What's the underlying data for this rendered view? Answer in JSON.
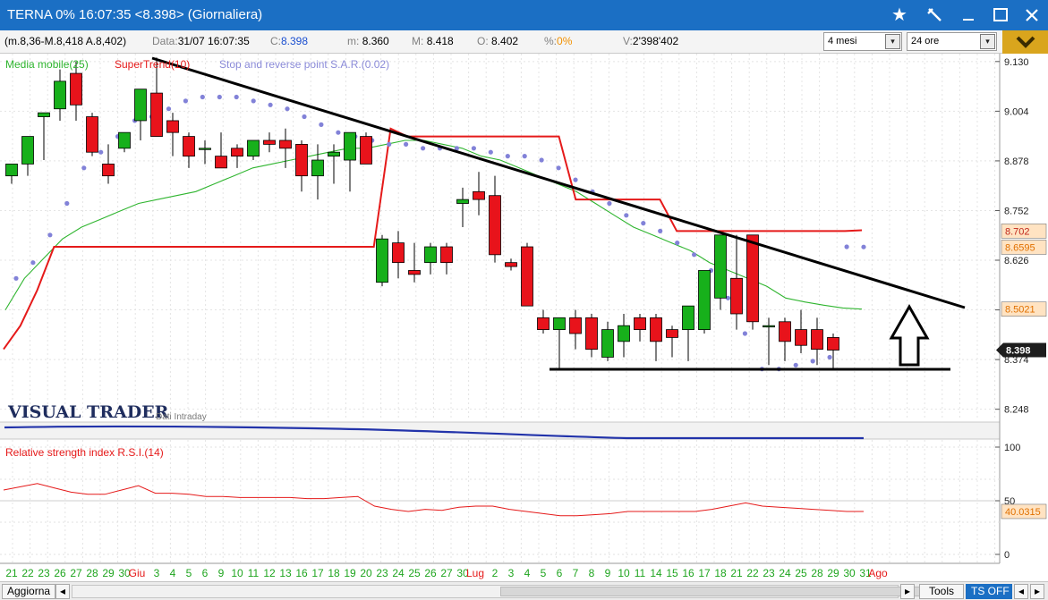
{
  "window": {
    "title": "TERNA 0%  16:07:35  <8.398>  (Giornaliera)",
    "controls": [
      "star-icon",
      "pin-icon",
      "minimize-icon",
      "maximize-icon",
      "close-icon"
    ]
  },
  "infobar": {
    "range_label": "(m.8,36-M.8,418 A.8,402)",
    "data_label": "Data:",
    "data_value": "31/07 16:07:35",
    "c_label": "C:",
    "c_value": "8.398",
    "m_label": "m:",
    "m_value": "8.360",
    "M_label": "M:",
    "M_value": "8.418",
    "o_label": "O:",
    "o_value": "8.402",
    "pct_label": "%:",
    "pct_value": "0%",
    "v_label": "V:",
    "v_value": "2'398'402",
    "period_select": "4 mesi",
    "interval_select": "24 ore"
  },
  "legend": {
    "ma": "Media mobile(25)",
    "supertrend": "SuperTrend(10)",
    "sar": "Stop and reverse point S.A.R.(0.02)"
  },
  "watermark": {
    "brand": "VISUAL TRADER",
    "sub": "Dati Intraday"
  },
  "price_axis": {
    "ticks": [
      "9.130",
      "9.004",
      "8.878",
      "8.752",
      "8.626",
      "8.500",
      "8.374",
      "8.248"
    ],
    "ytick_values": [
      9.13,
      9.004,
      8.878,
      8.752,
      8.626,
      8.5,
      8.374,
      8.248
    ]
  },
  "price_labels": {
    "supertrend": "8.702",
    "sar": "8.6595",
    "ma": "8.5021",
    "last": "8.398"
  },
  "rsi": {
    "label": "Relative strength index R.S.I.(14)",
    "ticks": [
      "100",
      "50",
      "0"
    ],
    "last": "40.0315"
  },
  "x_axis": {
    "labels": [
      "21",
      "22",
      "23",
      "26",
      "27",
      "28",
      "29",
      "30",
      "Giu",
      "3",
      "4",
      "5",
      "6",
      "9",
      "10",
      "11",
      "12",
      "13",
      "16",
      "17",
      "18",
      "19",
      "20",
      "23",
      "24",
      "25",
      "26",
      "27",
      "30",
      "Lug",
      "2",
      "3",
      "4",
      "5",
      "6",
      "7",
      "8",
      "9",
      "10",
      "11",
      "14",
      "15",
      "16",
      "17",
      "18",
      "21",
      "22",
      "23",
      "24",
      "25",
      "28",
      "29",
      "30",
      "31",
      "Ago"
    ],
    "highlight": [
      "Giu",
      "Lug",
      "Ago"
    ]
  },
  "bottombar": {
    "refresh": "Aggiorna",
    "tools": "Tools",
    "ts": "TS OFF"
  },
  "colors": {
    "up": "#17b01b",
    "down": "#e8131b",
    "ma": "#2fb52f",
    "supertrend": "#e51a1a",
    "sar": "#8282d8",
    "rsi": "#e51a1a",
    "volume": "#2233aa",
    "titlebar": "#1b6fc4"
  },
  "chart_data": {
    "type": "candlestick",
    "x": [
      "21",
      "22",
      "23",
      "26",
      "27",
      "28",
      "29",
      "30",
      "Giu",
      "3",
      "4",
      "5",
      "6",
      "9",
      "10",
      "11",
      "12",
      "13",
      "16",
      "17",
      "18",
      "19",
      "20",
      "23",
      "24",
      "25",
      "26",
      "27",
      "30",
      "Lug",
      "2",
      "3",
      "4",
      "5",
      "6",
      "7",
      "8",
      "9",
      "10",
      "11",
      "14",
      "15",
      "16",
      "17",
      "18",
      "21",
      "22",
      "23",
      "24",
      "25",
      "28",
      "29",
      "30",
      "31"
    ],
    "open": [
      8.84,
      8.87,
      8.99,
      9.01,
      9.1,
      8.99,
      8.87,
      8.91,
      8.98,
      9.05,
      8.98,
      8.94,
      8.91,
      8.89,
      8.91,
      8.89,
      8.93,
      8.93,
      8.92,
      8.84,
      8.89,
      8.88,
      8.94,
      8.57,
      8.67,
      8.6,
      8.62,
      8.66,
      8.77,
      8.8,
      8.79,
      8.62,
      8.66,
      8.48,
      8.45,
      8.48,
      8.48,
      8.38,
      8.42,
      8.48,
      8.48,
      8.45,
      8.45,
      8.45,
      8.53,
      8.58,
      8.69,
      8.46,
      8.47,
      8.45,
      8.45,
      8.43
    ],
    "high": [
      8.86,
      8.92,
      9.0,
      9.11,
      9.13,
      9.0,
      8.92,
      8.95,
      9.05,
      9.14,
      9.0,
      8.95,
      8.93,
      8.95,
      8.92,
      8.91,
      8.95,
      8.96,
      8.93,
      8.92,
      8.92,
      8.92,
      8.95,
      8.69,
      8.7,
      8.67,
      8.67,
      8.67,
      8.81,
      8.85,
      8.84,
      8.63,
      8.67,
      8.5,
      8.46,
      8.5,
      8.49,
      8.47,
      8.49,
      8.49,
      8.49,
      8.46,
      8.47,
      8.55,
      8.64,
      8.69,
      8.69,
      8.48,
      8.48,
      8.5,
      8.48,
      8.44
    ],
    "low": [
      8.82,
      8.84,
      8.88,
      8.98,
      8.98,
      8.89,
      8.82,
      8.9,
      8.93,
      8.95,
      8.89,
      8.86,
      8.87,
      8.86,
      8.86,
      8.88,
      8.9,
      8.86,
      8.8,
      8.78,
      8.82,
      8.8,
      8.87,
      8.56,
      8.58,
      8.57,
      8.59,
      8.59,
      8.71,
      8.74,
      8.62,
      8.6,
      8.52,
      8.44,
      8.35,
      8.4,
      8.38,
      8.37,
      8.38,
      8.42,
      8.37,
      8.38,
      8.37,
      8.44,
      8.5,
      8.45,
      8.45,
      8.36,
      8.37,
      8.39,
      8.36,
      8.35
    ],
    "close": [
      8.87,
      8.94,
      9.0,
      9.08,
      9.02,
      8.9,
      8.84,
      8.95,
      9.06,
      8.94,
      8.95,
      8.89,
      8.91,
      8.86,
      8.89,
      8.93,
      8.92,
      8.91,
      8.84,
      8.88,
      8.9,
      8.95,
      8.87,
      8.68,
      8.62,
      8.59,
      8.66,
      8.62,
      8.78,
      8.78,
      8.64,
      8.61,
      8.51,
      8.45,
      8.48,
      8.44,
      8.4,
      8.45,
      8.46,
      8.45,
      8.42,
      8.43,
      8.51,
      8.6,
      8.69,
      8.49,
      8.47,
      8.46,
      8.42,
      8.41,
      8.4,
      8.398
    ],
    "volume_indicator": "sparse",
    "ma_25": [
      8.5,
      8.58,
      8.63,
      8.68,
      8.71,
      8.73,
      8.75,
      8.77,
      8.78,
      8.79,
      8.8,
      8.82,
      8.84,
      8.86,
      8.87,
      8.88,
      8.89,
      8.9,
      8.91,
      8.91,
      8.92,
      8.93,
      8.93,
      8.92,
      8.91,
      8.89,
      8.88,
      8.86,
      8.84,
      8.82,
      8.8,
      8.77,
      8.74,
      8.71,
      8.69,
      8.67,
      8.65,
      8.62,
      8.6,
      8.58,
      8.56,
      8.53,
      8.52,
      8.512,
      8.505,
      8.502
    ],
    "supertrend": [
      8.4,
      8.46,
      8.55,
      8.66,
      8.66,
      8.66,
      8.66,
      8.66,
      8.66,
      8.66,
      8.66,
      8.66,
      8.66,
      8.66,
      8.66,
      8.66,
      8.66,
      8.66,
      8.66,
      8.66,
      8.66,
      8.66,
      8.66,
      8.96,
      8.94,
      8.94,
      8.94,
      8.94,
      8.94,
      8.94,
      8.94,
      8.94,
      8.94,
      8.94,
      8.78,
      8.78,
      8.78,
      8.78,
      8.78,
      8.78,
      8.7,
      8.7,
      8.7,
      8.7,
      8.7,
      8.7,
      8.7,
      8.7,
      8.7,
      8.7,
      8.7,
      8.702
    ],
    "sar": [
      8.58,
      8.62,
      8.69,
      8.77,
      8.86,
      8.9,
      8.94,
      8.98,
      8.99,
      9.01,
      9.03,
      9.04,
      9.04,
      9.04,
      9.03,
      9.02,
      9.01,
      8.99,
      8.97,
      8.95,
      8.94,
      8.93,
      8.92,
      8.92,
      8.91,
      8.91,
      8.91,
      8.91,
      8.9,
      8.89,
      8.89,
      8.88,
      8.86,
      8.83,
      8.8,
      8.77,
      8.74,
      8.72,
      8.7,
      8.67,
      8.64,
      8.6,
      8.53,
      8.44,
      8.35,
      8.35,
      8.36,
      8.37,
      8.38,
      8.66,
      8.6595
    ],
    "rsi_14": [
      60,
      63,
      66,
      62,
      58,
      56,
      56,
      60,
      64,
      57,
      57,
      56,
      54,
      54,
      53,
      53,
      53,
      53,
      52,
      52,
      53,
      54,
      45,
      42,
      40,
      42,
      41,
      44,
      45,
      45,
      42,
      40,
      38,
      36,
      36,
      37,
      38,
      40,
      40,
      40,
      40,
      40,
      42,
      45,
      48,
      45,
      44,
      43,
      42,
      41,
      40,
      40.03
    ],
    "ylim": [
      8.22,
      9.15
    ],
    "rsi_ylim": [
      0,
      100
    ],
    "grid": true
  }
}
